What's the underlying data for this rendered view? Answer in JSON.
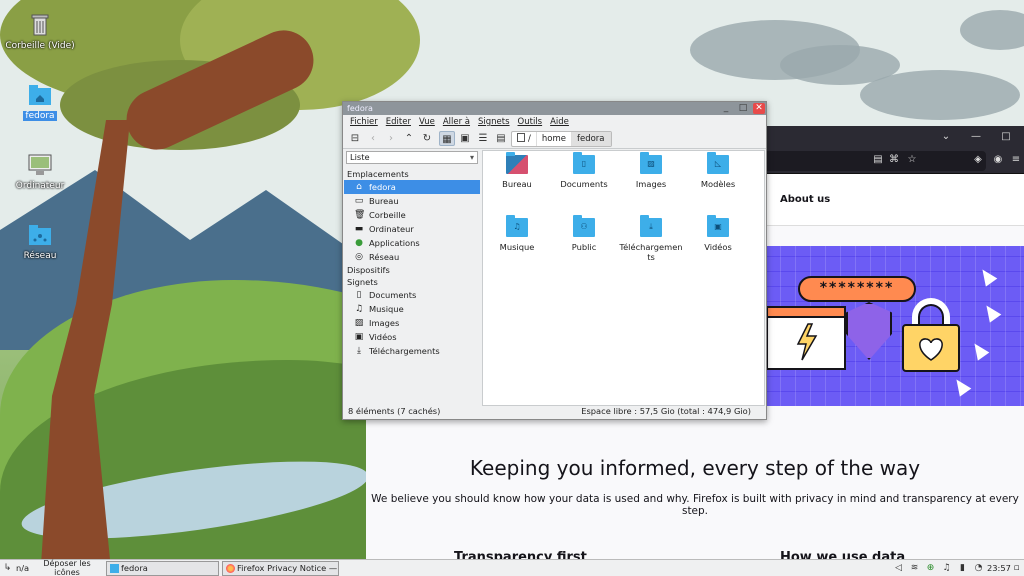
{
  "desktop": {
    "icons": [
      {
        "label": "Corbeille (Vide)",
        "icon": "trash-icon"
      },
      {
        "label": "fedora",
        "icon": "home-folder-icon"
      },
      {
        "label": "Ordinateur",
        "icon": "computer-icon"
      },
      {
        "label": "Réseau",
        "icon": "network-icon"
      }
    ]
  },
  "dolphin": {
    "title": "fedora",
    "menu": [
      "Fichier",
      "Editer",
      "Vue",
      "Aller à",
      "Signets",
      "Outils",
      "Aide"
    ],
    "breadcrumb": [
      "/",
      "home",
      "fedora"
    ],
    "view_mode": "Liste",
    "sidebar": {
      "places_header": "Emplacements",
      "places": [
        {
          "label": "fedora",
          "icon": "home-icon",
          "selected": true
        },
        {
          "label": "Bureau",
          "icon": "desktop-icon"
        },
        {
          "label": "Corbeille",
          "icon": "trash-icon"
        },
        {
          "label": "Ordinateur",
          "icon": "computer-icon"
        },
        {
          "label": "Applications",
          "icon": "applications-icon"
        },
        {
          "label": "Réseau",
          "icon": "network-icon"
        }
      ],
      "devices_header": "Dispositifs",
      "bookmarks_header": "Signets",
      "bookmarks": [
        {
          "label": "Documents",
          "icon": "document-icon"
        },
        {
          "label": "Musique",
          "icon": "music-icon"
        },
        {
          "label": "Images",
          "icon": "image-icon"
        },
        {
          "label": "Vidéos",
          "icon": "video-icon"
        },
        {
          "label": "Téléchargements",
          "icon": "download-icon"
        }
      ]
    },
    "files": [
      {
        "label": "Bureau",
        "icon": "desktop-folder-icon"
      },
      {
        "label": "Documents",
        "icon": "documents-folder-icon"
      },
      {
        "label": "Images",
        "icon": "pictures-folder-icon"
      },
      {
        "label": "Modèles",
        "icon": "templates-folder-icon"
      },
      {
        "label": "Musique",
        "icon": "music-folder-icon"
      },
      {
        "label": "Public",
        "icon": "public-folder-icon"
      },
      {
        "label": "Téléchargements",
        "icon": "downloads-folder-icon"
      },
      {
        "label": "Vidéos",
        "icon": "videos-folder-icon"
      }
    ],
    "status_left": "8 éléments (7 cachés)",
    "status_right": "Espace libre : 57,5 Gio (total : 474,9 Gio)"
  },
  "firefox": {
    "nav_about": "About us",
    "password_mask": "********",
    "headline": "Keeping you informed, every step of the way",
    "body": "We believe you should know how your data is used and why. Firefox is built with privacy in mind and transparency at every step.",
    "sub_left": "Transparency first",
    "sub_right": "How we use data",
    "accent": "#6c5cf5"
  },
  "taskbar": {
    "na_label": "n/a",
    "drop_hint": "Déposer les icônes d'application ici",
    "tasks": [
      {
        "label": "fedora",
        "icon": "folder-icon"
      },
      {
        "label": "Firefox Privacy Notice — ...",
        "icon": "firefox-icon"
      }
    ],
    "clock": "23:57"
  }
}
